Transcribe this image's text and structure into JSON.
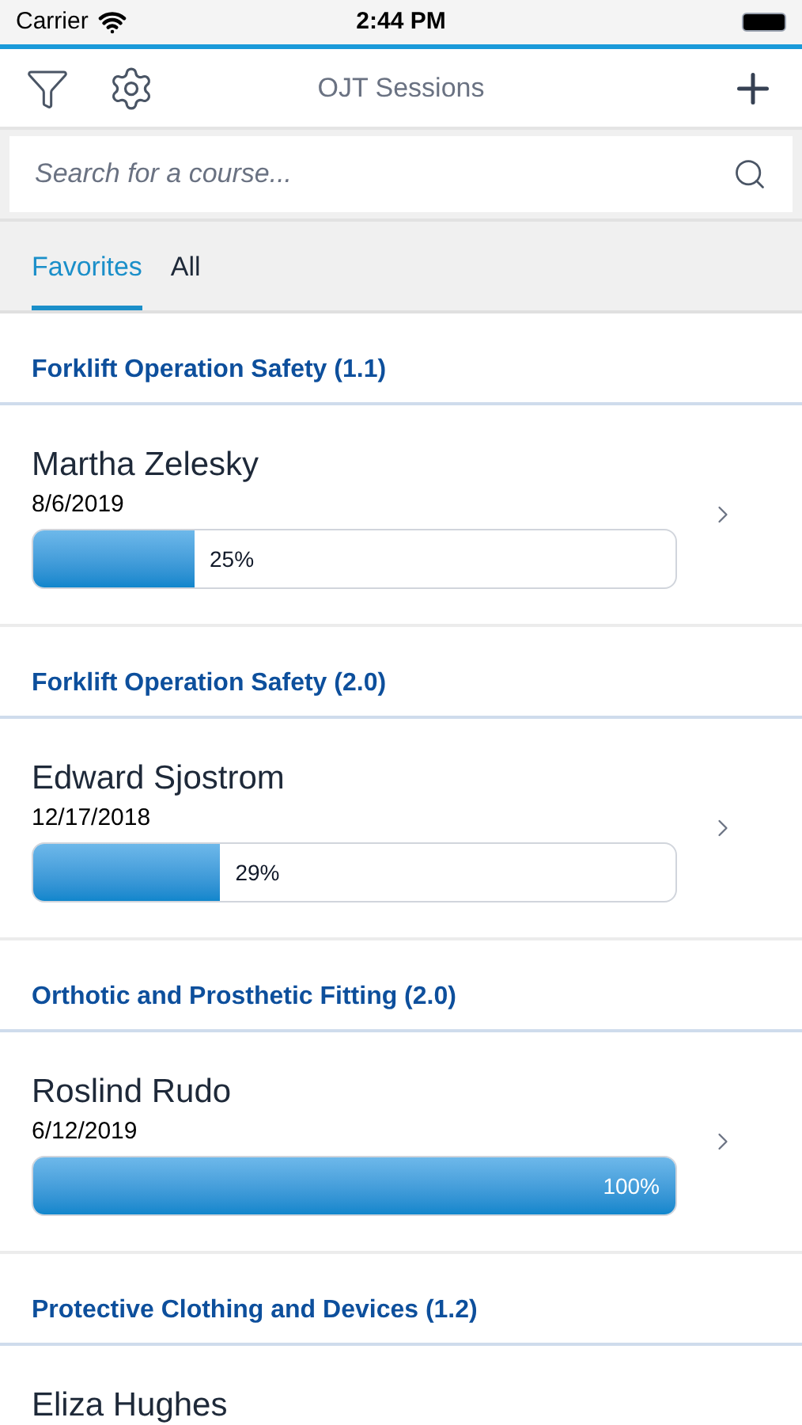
{
  "status_bar": {
    "carrier": "Carrier",
    "time": "2:44 PM"
  },
  "nav": {
    "title": "OJT Sessions"
  },
  "search": {
    "placeholder": "Search for a course..."
  },
  "tabs": [
    {
      "label": "Favorites",
      "selected": true
    },
    {
      "label": "All",
      "selected": false
    }
  ],
  "sections": [
    {
      "title": "Forklift Operation Safety (1.1)",
      "sessions": [
        {
          "name": "Martha Zelesky",
          "date": "8/6/2019",
          "level": 0.25,
          "reading": "25%"
        }
      ]
    },
    {
      "title": "Forklift Operation Safety (2.0)",
      "sessions": [
        {
          "name": "Edward Sjostrom",
          "date": "12/17/2018",
          "level": 0.29,
          "reading": "29%"
        }
      ]
    },
    {
      "title": "Orthotic and Prosthetic Fitting (2.0)",
      "sessions": [
        {
          "name": "Roslind Rudo",
          "date": "6/12/2019",
          "level": 1,
          "reading": "100%"
        }
      ]
    },
    {
      "title": "Protective Clothing and Devices (1.2)",
      "sessions": [
        {
          "name": "Eliza Hughes"
        }
      ]
    }
  ]
}
